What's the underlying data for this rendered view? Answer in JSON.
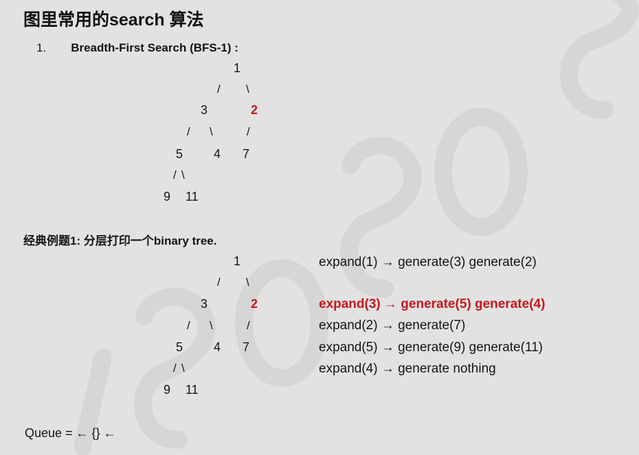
{
  "page": {
    "title": "图里常用的search 算法",
    "subtitle_number": "1.",
    "subtitle_text": "Breadth-First Search (BFS-1) :",
    "section_title": "经典例题1:  分层打印一个binary tree.",
    "queue_label": "Queue = ← {} ←",
    "highlight_color": "#c8171b"
  },
  "tree1": {
    "nodes": {
      "n1": "1",
      "n3": "3",
      "n2": "2",
      "n5": "5",
      "n4": "4",
      "n7": "7",
      "n9": "9",
      "n11": "11"
    },
    "edges": {
      "e1_3": "/",
      "e1_2": "\\",
      "e3_5": "/",
      "e3_4": "\\",
      "e2_7": "/",
      "e5_9": "/",
      "e5_11": "\\"
    }
  },
  "tree2": {
    "nodes": {
      "n1": "1",
      "n3": "3",
      "n2": "2",
      "n5": "5",
      "n4": "4",
      "n7": "7",
      "n9": "9",
      "n11": "11"
    },
    "edges": {
      "e1_3": "/",
      "e1_2": "\\",
      "e3_5": "/",
      "e3_4": "\\",
      "e2_7": "/",
      "e5_9": "/",
      "e5_11": "\\"
    }
  },
  "steps": [
    "expand(1) → generate(3) generate(2)",
    "expand(3) → generate(5) generate(4)",
    "expand(2) → generate(7)",
    "expand(5) → generate(9) generate(11)",
    "expand(4) → generate nothing"
  ]
}
